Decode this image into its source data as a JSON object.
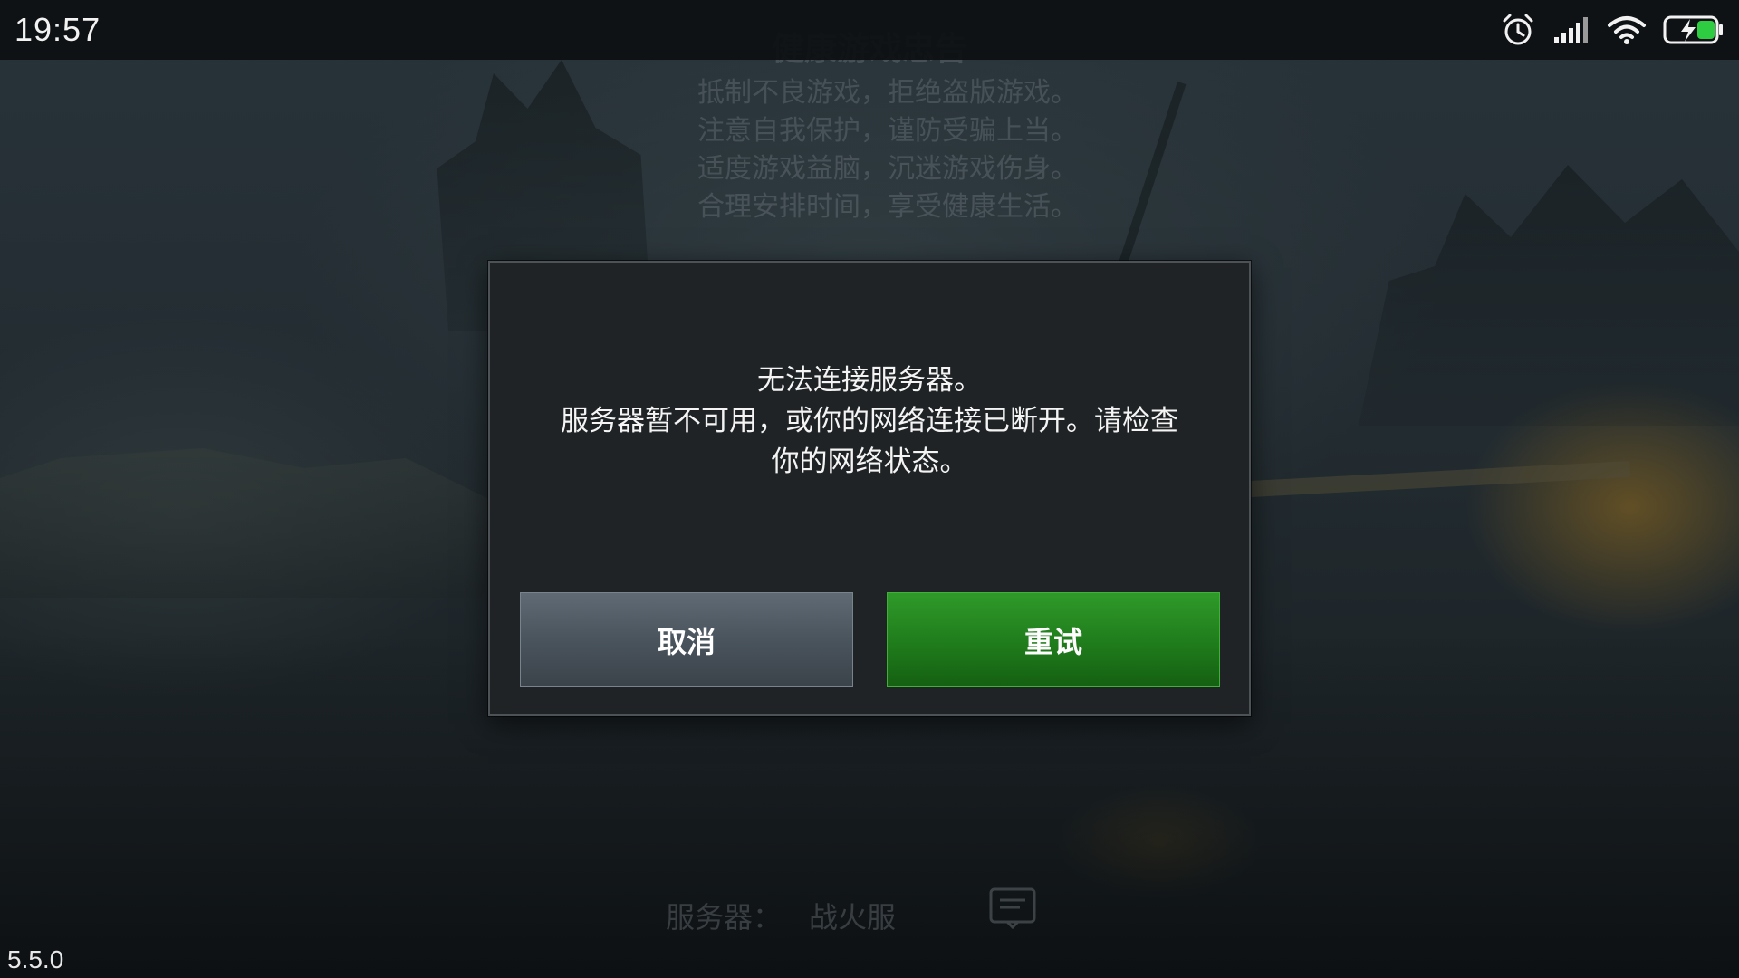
{
  "status_bar": {
    "time": "19:57",
    "icons": [
      "alarm-icon",
      "signal-icon",
      "wifi-icon",
      "battery-charging-icon"
    ],
    "battery_color": "#2ecc40"
  },
  "health_notice": {
    "title": "健康游戏忠告",
    "lines": [
      "抵制不良游戏，拒绝盗版游戏。",
      "注意自我保护，谨防受骗上当。",
      "适度游戏益脑，沉迷游戏伤身。",
      "合理安排时间，享受健康生活。"
    ]
  },
  "dialog": {
    "message_lines": [
      "无法连接服务器。",
      "服务器暂不可用，或你的网络连接已断开。请检查",
      "你的网络状态。"
    ],
    "cancel_label": "取消",
    "retry_label": "重试",
    "retry_color": "#1f7c1b",
    "cancel_color": "#4a545d"
  },
  "server": {
    "label": "服务器：",
    "name": "战火服"
  },
  "version": "5.5.0"
}
